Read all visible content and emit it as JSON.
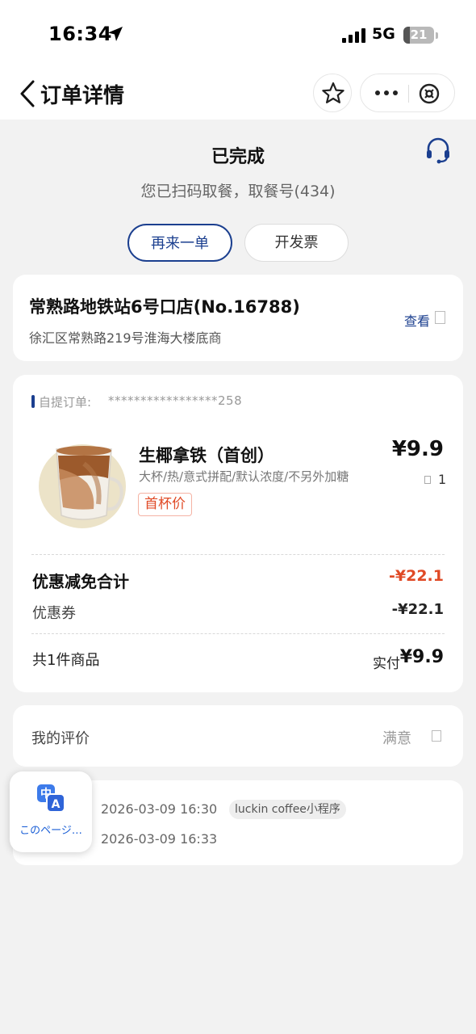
{
  "status_bar": {
    "time": "16:34",
    "network": "5G",
    "battery": "21",
    "battery_level": 0.21
  },
  "nav": {
    "title": "订单详情"
  },
  "order_status": {
    "title": "已完成",
    "subtitle": "您已扫码取餐，取餐号(434)",
    "reorder_label": "再来一单",
    "invoice_label": "开发票"
  },
  "store": {
    "name": "常熟路地铁站6号口店(No.16788)",
    "address": "徐汇区常熟路219号淮海大楼底商",
    "view_label": "查看"
  },
  "order": {
    "type_label": "自提订单:",
    "number": "*****************258",
    "product": {
      "name": "生椰拿铁（首创）",
      "spec": "大杯/热/意式拼配/默认浓度/不另外加糖",
      "tag": "首杯价",
      "price": "¥9.9",
      "quantity": "1"
    },
    "discount_total_label": "优惠减免合计",
    "discount_total": "-¥22.1",
    "coupon_label": "优惠券",
    "coupon_value": "-¥22.1",
    "item_count": "共1件商品",
    "paid_label": "实付",
    "paid_value": "¥9.9"
  },
  "review": {
    "label": "我的评价",
    "value": "满意"
  },
  "timeline": {
    "order_time": "2026-03-09 16:30",
    "source": "luckin coffee小程序",
    "complete_time": "2026-03-09 16:33"
  },
  "translate_widget": {
    "label": "このページ…"
  },
  "colors": {
    "brand_blue": "#1b3f8f",
    "discount_red": "#e04a26",
    "background": "#f2f2f2"
  }
}
